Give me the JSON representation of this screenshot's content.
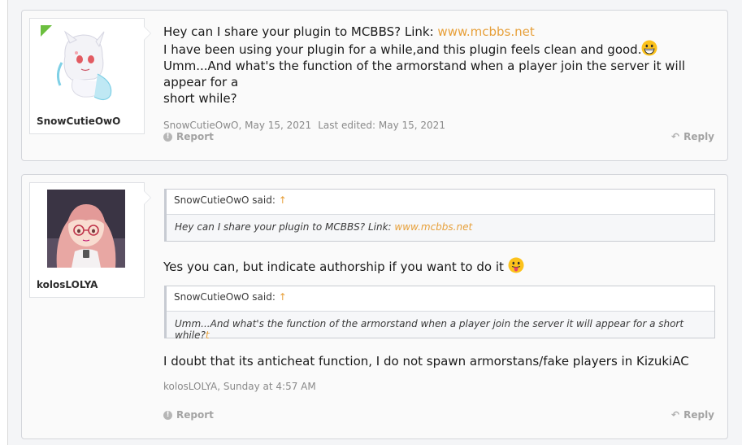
{
  "colors": {
    "link": "#e7a03a",
    "meta": "#8a8a8a",
    "background": "#f4f5f7",
    "card_border": "#d4d6db"
  },
  "posts": [
    {
      "username": "SnowCutieOwO",
      "avatar_icon": "anime-white-hair-avatar",
      "line1_text": "Hey can I share your plugin to MCBBS? Link: ",
      "line1_link": "www.mcbbs.net",
      "line2_text": "I have been using your plugin for a while,and this plugin feels clean and good.",
      "line2_emoji": "grinning-face-emoji",
      "line3_text": "Umm...And what's the function of the armorstand when a player join the server it will appear for a",
      "line4_text": "short while?",
      "meta_author_date": "SnowCutieOwO, May 15, 2021",
      "meta_edited": "Last edited: May 15, 2021",
      "report_label": "Report",
      "reply_label": "Reply"
    },
    {
      "username": "kolosLOLYA",
      "avatar_icon": "anime-pink-hair-avatar",
      "quote1": {
        "head": "SnowCutieOwO said:",
        "arrow": "↑",
        "body_text": "Hey can I share your plugin to MCBBS? Link: ",
        "body_link": "www.mcbbs.net"
      },
      "reply1_text": "Yes you can, but indicate authorship if you want to do it",
      "reply1_emoji": "tongue-out-emoji",
      "quote2": {
        "head": "SnowCutieOwO said:",
        "arrow": "↑",
        "body_text": "Umm...And what's the function of the armorstand when a player join the server it will appear for a short while?",
        "body_tail": "t"
      },
      "reply2_text": "I doubt that its anticheat function, I do not spawn armorstans/fake players in KizukiAC",
      "meta_author_date": "kolosLOLYA, Sunday at 4:57 AM",
      "report_label": "Report",
      "reply_label": "Reply"
    }
  ]
}
